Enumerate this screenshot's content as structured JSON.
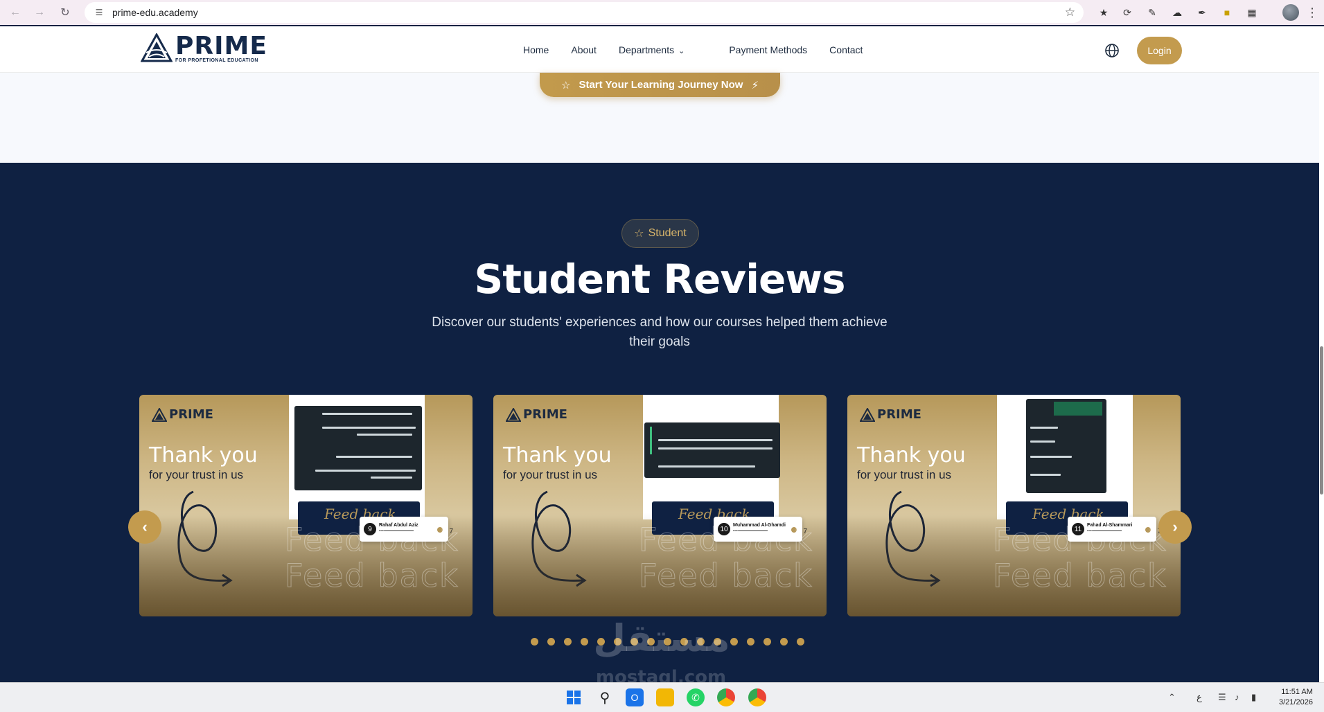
{
  "browser": {
    "url": "prime-edu.academy"
  },
  "site": {
    "logo_word": "PRIME",
    "logo_sub": "FOR PROFETIONAL EDUCATION",
    "menu": [
      "Home",
      "About",
      "Departments",
      "Payment Methods",
      "Contact"
    ],
    "login_label": "Login",
    "cta_label": "Start Your Learning Journey Now"
  },
  "reviews": {
    "badge": "Student",
    "title": "Student Reviews",
    "subtitle": "Discover our students' experiences and how our courses helped them achieve their goals",
    "cards": [
      {
        "thanks": "Thank you",
        "trust": "for your trust in us",
        "logo": "PRIME",
        "feedback": "Feed back",
        "number": "9",
        "name": "Rahaf Abdul Aziz"
      },
      {
        "thanks": "Thank you",
        "trust": "for your trust in us",
        "logo": "PRIME",
        "feedback": "Feed back",
        "number": "10",
        "name": "Muhammad Al-Ghamdi"
      },
      {
        "thanks": "Thank you",
        "trust": "for your trust in us",
        "logo": "PRIME",
        "feedback": "Feed back",
        "number": "11",
        "name": "Fahad Al-Shammari"
      }
    ],
    "dot_count": 17,
    "watermark": "مستقل",
    "watermark_sub": "mostaql.com"
  },
  "taskbar": {
    "time": "11:51 AM",
    "date": "3/21/2026",
    "lang": "ع"
  },
  "colors": {
    "gold": "#c39b4e",
    "navy": "#0f2142"
  }
}
